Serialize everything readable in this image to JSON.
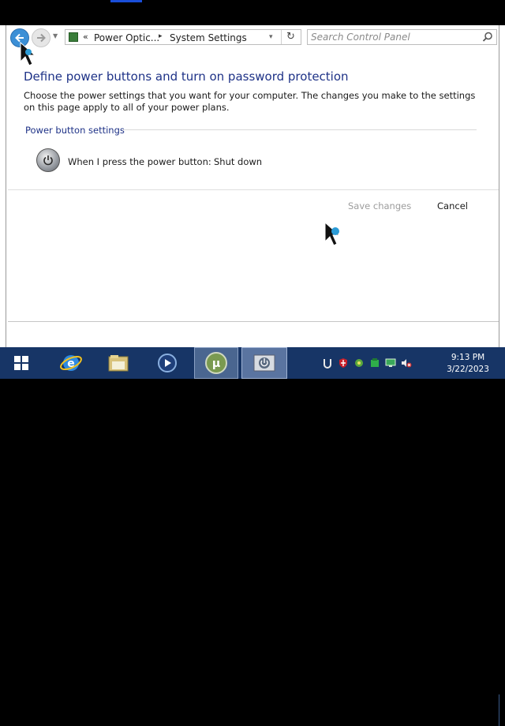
{
  "address_bar": {
    "breadcrumb_prefix": "«",
    "crumbs": [
      "Power Optic...",
      "System Settings"
    ],
    "separator": "▸",
    "dropdown_glyph": "▾",
    "refresh_glyph": "↻"
  },
  "search": {
    "placeholder": "Search Control Panel"
  },
  "page": {
    "title": "Define power buttons and turn on password protection",
    "description": "Choose the power settings that you want for your computer. The changes you make to the settings on this page apply to all of your power plans.",
    "section_label": "Power button settings",
    "power_button_label": "When I press the power button:",
    "power_button_value": "Shut down"
  },
  "actions": {
    "save_label": "Save changes",
    "cancel_label": "Cancel"
  },
  "taskbar": {
    "items": [
      "start-icon",
      "internet-explorer-icon",
      "file-explorer-icon",
      "media-player-icon",
      "utorrent-icon",
      "power-options-icon"
    ],
    "tray_icons": [
      "utorrent-tray-icon",
      "security-shield-icon",
      "network-icon",
      "green-app-icon",
      "monitor-icon",
      "volume-muted-icon"
    ],
    "time": "9:13 PM",
    "date": "3/22/2023"
  },
  "colors": {
    "title_blue": "#1e3287",
    "taskbar": "#173566",
    "disabled_text": "#9c9c9c"
  }
}
